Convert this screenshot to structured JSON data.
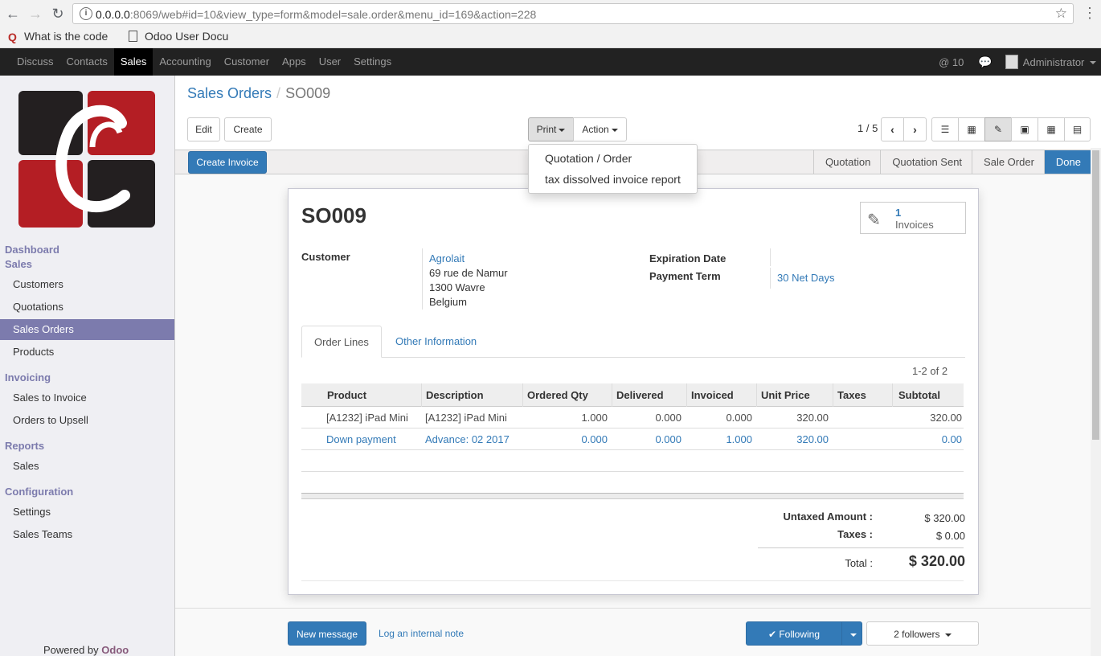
{
  "browser": {
    "url_host": "0.0.0.0",
    "url_rest": ":8069/web#id=10&view_type=form&model=sale.order&menu_id=169&action=228",
    "bookmarks": [
      "What is the code",
      "Odoo User Docu"
    ]
  },
  "topnav": {
    "menus": [
      "Discuss",
      "Contacts",
      "Sales",
      "Accounting",
      "Customer",
      "Apps",
      "User",
      "Settings"
    ],
    "active": "Sales",
    "notifications": "@ 10",
    "user": "Administrator"
  },
  "sidebar": {
    "sections": [
      {
        "title": "Dashboard"
      },
      {
        "title": "Sales",
        "items": [
          "Customers",
          "Quotations",
          "Sales Orders",
          "Products"
        ]
      },
      {
        "title": "Invoicing",
        "items": [
          "Sales to Invoice",
          "Orders to Upsell"
        ]
      },
      {
        "title": "Reports",
        "items": [
          "Sales"
        ]
      },
      {
        "title": "Configuration",
        "items": [
          "Settings",
          "Sales Teams"
        ]
      }
    ],
    "active_item": "Sales Orders",
    "powered_by": "Powered by",
    "brand": "Odoo"
  },
  "breadcrumb": {
    "parent": "Sales Orders",
    "current": "SO009"
  },
  "buttons": {
    "edit": "Edit",
    "create": "Create",
    "print": "Print",
    "action": "Action",
    "create_invoice": "Create Invoice"
  },
  "pager": "1 / 5",
  "print_menu": [
    "Quotation / Order",
    "tax dissolved invoice report"
  ],
  "stages": [
    "Quotation",
    "Quotation Sent",
    "Sale Order",
    "Done"
  ],
  "current_stage": "Done",
  "record": {
    "name": "SO009",
    "invoices_count": "1",
    "invoices_label": "Invoices",
    "customer_label": "Customer",
    "customer_name": "Agrolait",
    "address": [
      "69 rue de Namur",
      "1300 Wavre",
      "Belgium"
    ],
    "expiration_label": "Expiration Date",
    "payment_term_label": "Payment Term",
    "payment_term": "30 Net Days"
  },
  "tabs": [
    "Order Lines",
    "Other Information"
  ],
  "lines": {
    "count": "1-2 of 2",
    "columns": [
      "Product",
      "Description",
      "Ordered Qty",
      "Delivered",
      "Invoiced",
      "Unit Price",
      "Taxes",
      "Subtotal"
    ],
    "rows": [
      {
        "product": "[A1232] iPad Mini",
        "description": "[A1232] iPad Mini",
        "ordered": "1.000",
        "delivered": "0.000",
        "invoiced": "0.000",
        "unit_price": "320.00",
        "taxes": "",
        "subtotal": "320.00"
      },
      {
        "product": "Down payment",
        "description": "Advance: 02 2017",
        "ordered": "0.000",
        "delivered": "0.000",
        "invoiced": "1.000",
        "unit_price": "320.00",
        "taxes": "",
        "subtotal": "0.00"
      }
    ]
  },
  "totals": {
    "untaxed_label": "Untaxed Amount :",
    "untaxed": "$ 320.00",
    "taxes_label": "Taxes :",
    "taxes": "$ 0.00",
    "total_label": "Total :",
    "total": "$ 320.00"
  },
  "chatter": {
    "new_message": "New message",
    "log_note": "Log an internal note",
    "following": "Following",
    "followers": "2 followers"
  },
  "colors": {
    "primary": "#337ab7",
    "sidebar_accent": "#7c7bad",
    "topbar": "#222222"
  }
}
